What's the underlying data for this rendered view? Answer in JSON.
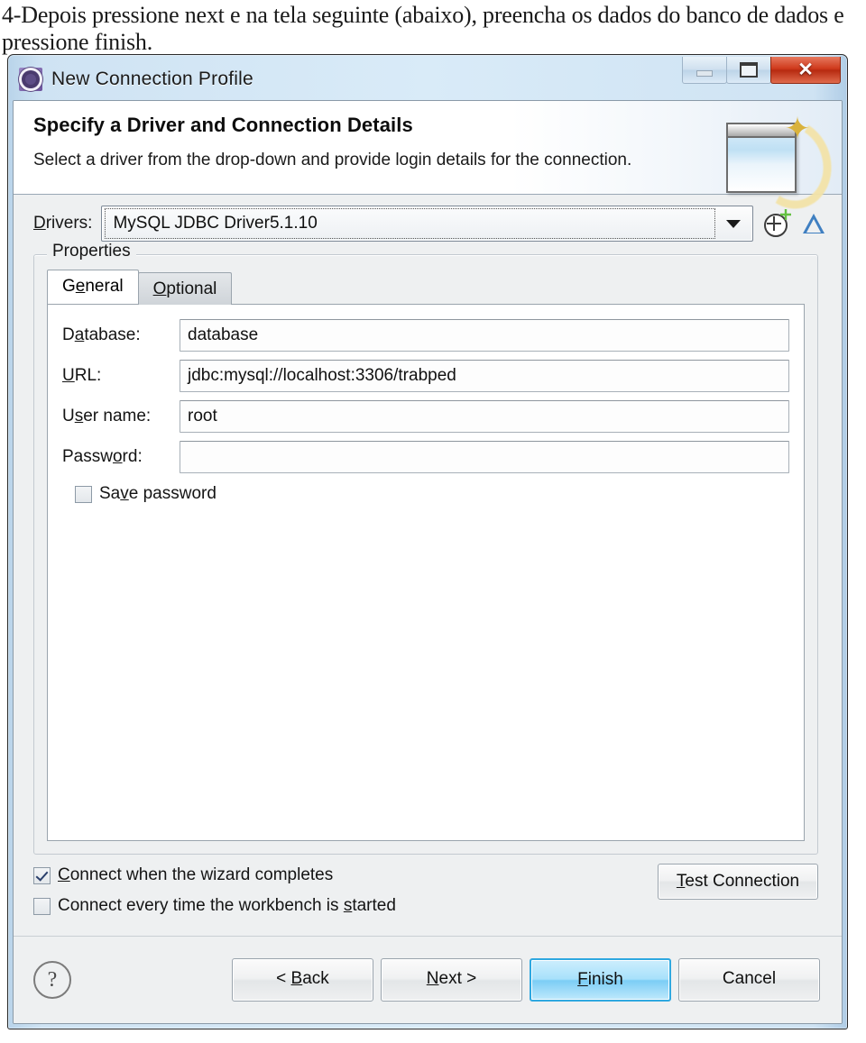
{
  "caption": "4-Depois pressione next e na tela seguinte (abaixo), preencha os dados do banco de dados e pressione finish.",
  "dialog": {
    "title": "New Connection Profile",
    "window_controls": {
      "minimize": "minimize-icon",
      "maximize": "maximize-icon",
      "close": "✕"
    },
    "banner": {
      "title": "Specify a Driver and Connection Details",
      "description": "Select a driver from the drop-down and provide login details for the connection.",
      "image": "wizard-window-sparkle-image"
    },
    "drivers": {
      "label": "Drivers:",
      "value": "MySQL JDBC Driver5.1.10",
      "arrow_icon": "chevron-down-icon",
      "new_driver_icon": "new-driver-definition-icon",
      "edit_driver_icon": "edit-driver-definition-icon"
    },
    "properties": {
      "legend": "Properties",
      "tabs": [
        {
          "label": "General",
          "active": true
        },
        {
          "label": "Optional",
          "active": false
        }
      ],
      "fields": [
        {
          "label": "Database:",
          "value": "database",
          "placeholder": ""
        },
        {
          "label": "URL:",
          "value": "jdbc:mysql://localhost:3306/trabped",
          "placeholder": ""
        },
        {
          "label": "User name:",
          "value": "root",
          "placeholder": ""
        },
        {
          "label": "Password:",
          "value": "",
          "placeholder": ""
        }
      ],
      "save_password": {
        "label": "Save password",
        "checked": false
      }
    },
    "options": {
      "connect_on_complete": {
        "label": "Connect when the wizard completes",
        "checked": true
      },
      "connect_on_start": {
        "label": "Connect every time the workbench is started",
        "checked": false
      },
      "test_connection_label": "Test Connection"
    },
    "footer": {
      "help_icon": "?",
      "back_label": "< Back",
      "next_label": "Next >",
      "finish_label": "Finish",
      "cancel_label": "Cancel"
    },
    "colors": {
      "titlebar": "#d9ebf8",
      "close_button": "#cf3a1c",
      "default_button": "#7ccdf5",
      "client_background": "#eef0f1"
    }
  }
}
